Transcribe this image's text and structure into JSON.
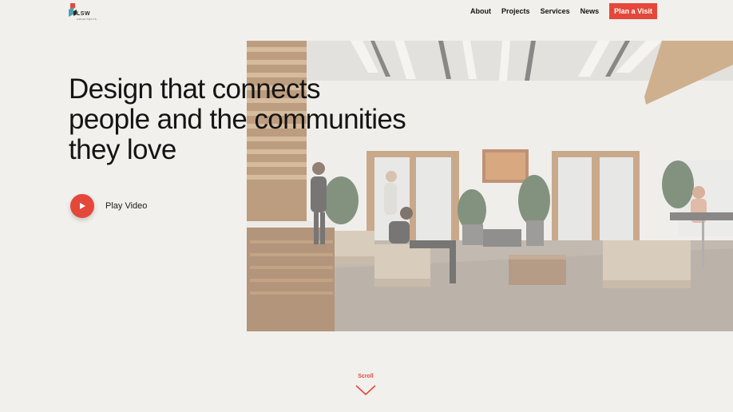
{
  "brand": {
    "name": "LSW",
    "sub": "ARCHITECTS",
    "accent_red": "#e4483a",
    "accent_teal": "#4aa3b5"
  },
  "nav": {
    "items": [
      {
        "label": "About"
      },
      {
        "label": "Projects"
      },
      {
        "label": "Services"
      },
      {
        "label": "News"
      }
    ],
    "cta_label": "Plan a Visit"
  },
  "hero": {
    "headline_lines": [
      "Design that connects",
      "people and the communities",
      "they love"
    ],
    "play_label": "Play Video",
    "image_icon": "office-lobby-photo"
  },
  "scroll": {
    "label": "Scroll",
    "icon": "chevron-down-icon"
  }
}
